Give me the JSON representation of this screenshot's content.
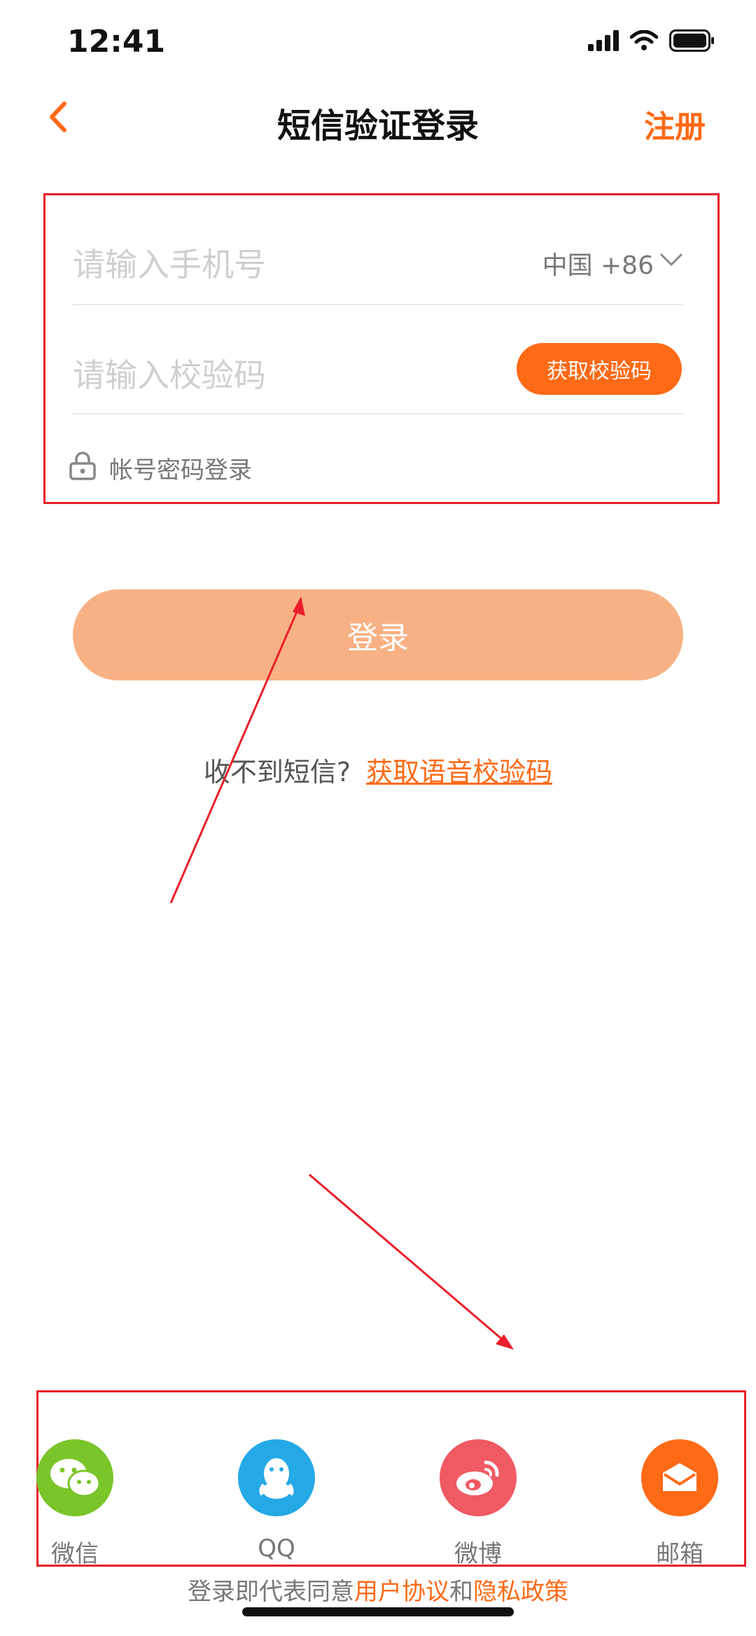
{
  "status": {
    "time": "12:41"
  },
  "nav": {
    "title": "短信验证登录",
    "register": "注册"
  },
  "form": {
    "phone_placeholder": "请输入手机号",
    "country": "中国 +86",
    "code_placeholder": "请输入校验码",
    "get_code": "获取校验码",
    "password_login": "帐号密码登录"
  },
  "login": {
    "label": "登录"
  },
  "sms": {
    "question": "收不到短信?",
    "voice_link": "获取语音校验码"
  },
  "social": {
    "items": [
      {
        "label": "微信",
        "color": "#7ac52a",
        "icon": "wechat-icon"
      },
      {
        "label": "QQ",
        "color": "#24a9e6",
        "icon": "qq-icon"
      },
      {
        "label": "微博",
        "color": "#f05a63",
        "icon": "weibo-icon"
      },
      {
        "label": "邮箱",
        "color": "#ff6a16",
        "icon": "mail-icon"
      }
    ]
  },
  "agreement": {
    "prefix": "登录即代表同意",
    "user": "用户协议",
    "and": "和",
    "privacy": "隐私政策"
  },
  "colors": {
    "accent": "#ff6a16",
    "login_button": "#f8b184",
    "annotation_red": "#e91e2a"
  }
}
